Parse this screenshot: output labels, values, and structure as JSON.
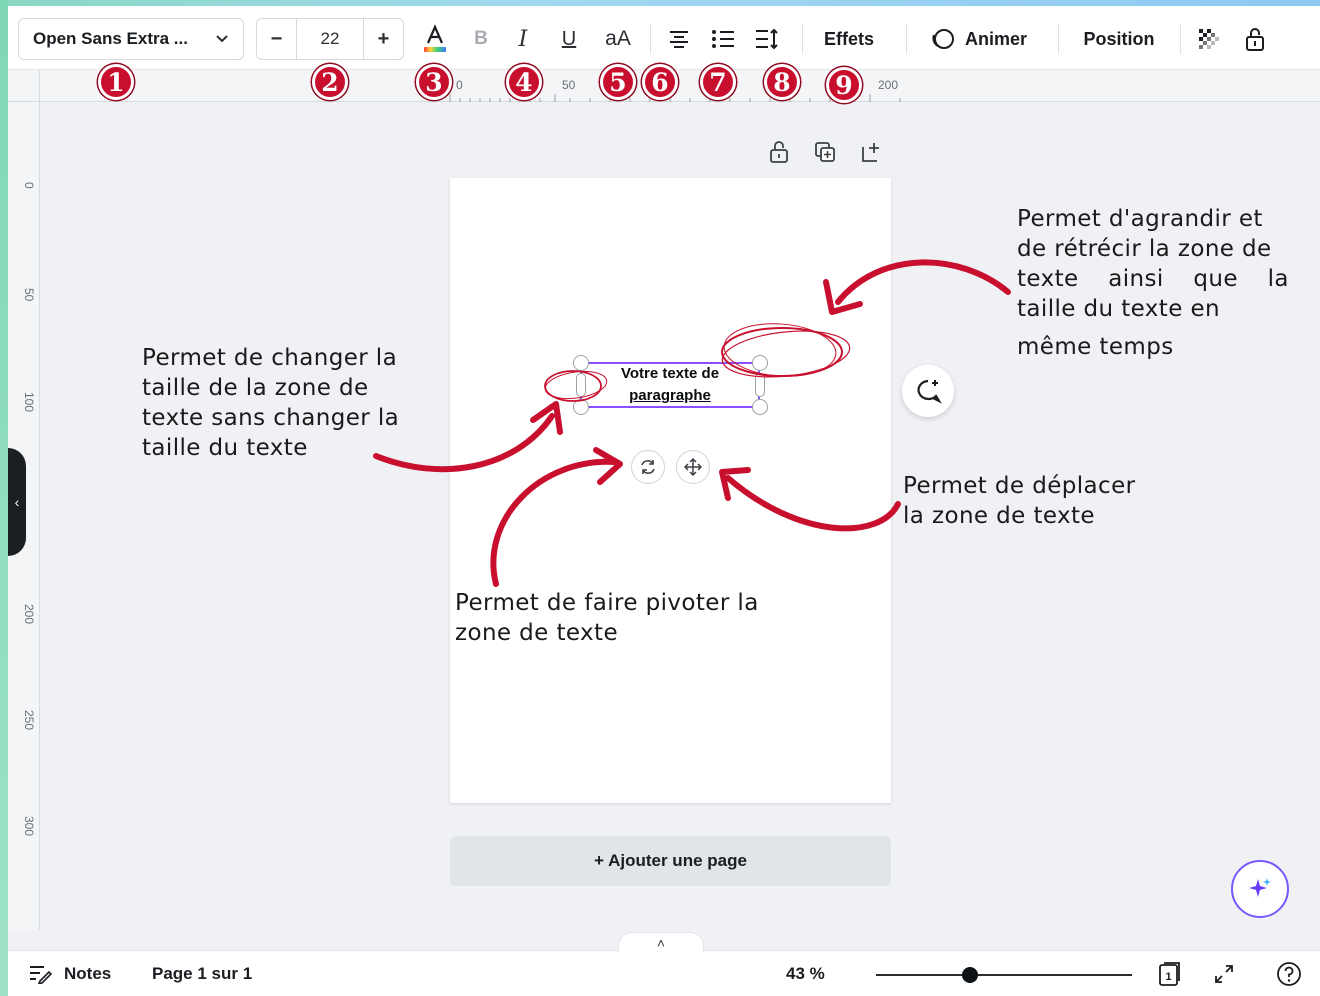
{
  "toolbar": {
    "font_name": "Open Sans Extra ...",
    "font_size": "22",
    "minus": "−",
    "plus": "+",
    "case_label": "aA",
    "effects_label": "Effets",
    "animate_label": "Animer",
    "position_label": "Position"
  },
  "badges": [
    "1",
    "2",
    "3",
    "4",
    "5",
    "6",
    "7",
    "8",
    "9"
  ],
  "ruler_top": [
    "0",
    "50",
    "200"
  ],
  "ruler_left": [
    "0",
    "50",
    "100",
    "200",
    "250",
    "300"
  ],
  "textbox": {
    "line1": "Votre texte de",
    "line2": "paragraphe"
  },
  "add_page_label": "+ Ajouter une page",
  "annotations": {
    "resize_box": [
      "Permet de changer la",
      "taille de la zone de",
      "texte sans changer la",
      "taille du texte"
    ],
    "scale": [
      "Permet d'agrandir et",
      "de rétrécir la zone de",
      "texte ainsi que la",
      "taille du texte en",
      "même temps"
    ],
    "move": [
      "Permet de déplacer",
      "la zone de texte"
    ],
    "rotate": [
      "Permet de faire pivoter la",
      "zone de texte"
    ]
  },
  "bottom": {
    "notes_label": "Notes",
    "page_info": "Page 1 sur 1",
    "zoom": "43 %",
    "page_count": "1"
  },
  "colors": {
    "annotation_red": "#c8102e",
    "selection_purple": "#8a4fff"
  }
}
